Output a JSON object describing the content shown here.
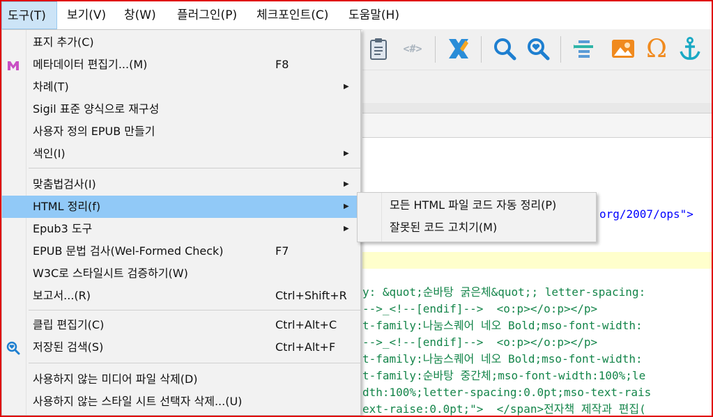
{
  "menubar": {
    "items": [
      "도구(T)",
      "보기(V)",
      "창(W)",
      "플러그인(P)",
      "체크포인트(C)",
      "도움말(H)"
    ]
  },
  "toolbar": {
    "icons": [
      "clipboard-icon",
      "code-tags-icon",
      "x-pencil-icon",
      "search-icon",
      "search-heart-icon",
      "align-icon",
      "image-icon",
      "omega-icon",
      "anchor-icon"
    ],
    "code_tag_text": "<#>"
  },
  "tools_menu": {
    "items": [
      {
        "label": "표지 추가(C)",
        "shortcut": "",
        "arrow": false,
        "icon": ""
      },
      {
        "label": "메타데이터 편집기...(M)",
        "shortcut": "F8",
        "arrow": false,
        "icon": "metadata-m-icon"
      },
      {
        "label": "차례(T)",
        "shortcut": "",
        "arrow": true,
        "icon": ""
      },
      {
        "label": "Sigil 표준 양식으로 재구성",
        "shortcut": "",
        "arrow": false,
        "icon": ""
      },
      {
        "label": "사용자 정의 EPUB 만들기",
        "shortcut": "",
        "arrow": false,
        "icon": ""
      },
      {
        "label": "색인(I)",
        "shortcut": "",
        "arrow": true,
        "icon": ""
      },
      {
        "label": "맞춤법검사(I)",
        "shortcut": "",
        "arrow": true,
        "icon": ""
      },
      {
        "label": "HTML 정리(f)",
        "shortcut": "",
        "arrow": true,
        "icon": ""
      },
      {
        "label": "Epub3 도구",
        "shortcut": "",
        "arrow": true,
        "icon": ""
      },
      {
        "label": "EPUB 문법 검사(Wel-Formed Check)",
        "shortcut": "F7",
        "arrow": false,
        "icon": ""
      },
      {
        "label": "W3C로 스타일시트 검증하기(W)",
        "shortcut": "",
        "arrow": false,
        "icon": ""
      },
      {
        "label": "보고서...(R)",
        "shortcut": "Ctrl+Shift+R",
        "arrow": false,
        "icon": ""
      },
      {
        "label": "클립 편집기(C)",
        "shortcut": "Ctrl+Alt+C",
        "arrow": false,
        "icon": ""
      },
      {
        "label": "저장된 검색(S)",
        "shortcut": "Ctrl+Alt+F",
        "arrow": false,
        "icon": "saved-search-icon"
      },
      {
        "label": "사용하지 않는 미디어 파일 삭제(D)",
        "shortcut": "",
        "arrow": false,
        "icon": ""
      },
      {
        "label": "사용하지 않는 스타일 시트 선택자 삭제...(U)",
        "shortcut": "",
        "arrow": false,
        "icon": ""
      }
    ],
    "highlighted_index": 7
  },
  "html_cleanup_submenu": {
    "items": [
      "모든 HTML 파일 코드 자동 정리(P)",
      "잘못된 코드 고치기(M)"
    ]
  },
  "editor": {
    "lines": [
      {
        "text": "org/2007/ops\">",
        "color": "#14854a"
      },
      {
        "text": "y: &quot;순바탕 굵은체&quot;; letter-spacing:",
        "color": "#14854a"
      },
      {
        "text": "-->_<!--[endif]-->  <o:p></o:p></p>",
        "color": "#14854a"
      },
      {
        "text": "t-family:나눔스퀘어 네오 Bold;mso-font-width:",
        "color": "#14854a"
      },
      {
        "text": "-->_<!--[endif]-->  <o:p></o:p></p>",
        "color": "#14854a"
      },
      {
        "text": "t-family:나눔스퀘어 네오 Bold;mso-font-width:",
        "color": "#14854a"
      },
      {
        "text": "t-family:순바탕 중간체;mso-font-width:100%;le",
        "color": "#14854a"
      },
      {
        "text": "dth:100%;letter-spacing:0.0pt;mso-text-rais",
        "color": "#14854a"
      },
      {
        "text": "ext-raise:0.0pt;\">  </span>전자책 제작과 편집(",
        "color": "#14854a"
      }
    ]
  },
  "colors": {
    "highlight": "#91c9f7",
    "frame": "#e00000",
    "code_green": "#14854a",
    "code_blue": "#0000ff",
    "current_line": "#ffffcc"
  }
}
